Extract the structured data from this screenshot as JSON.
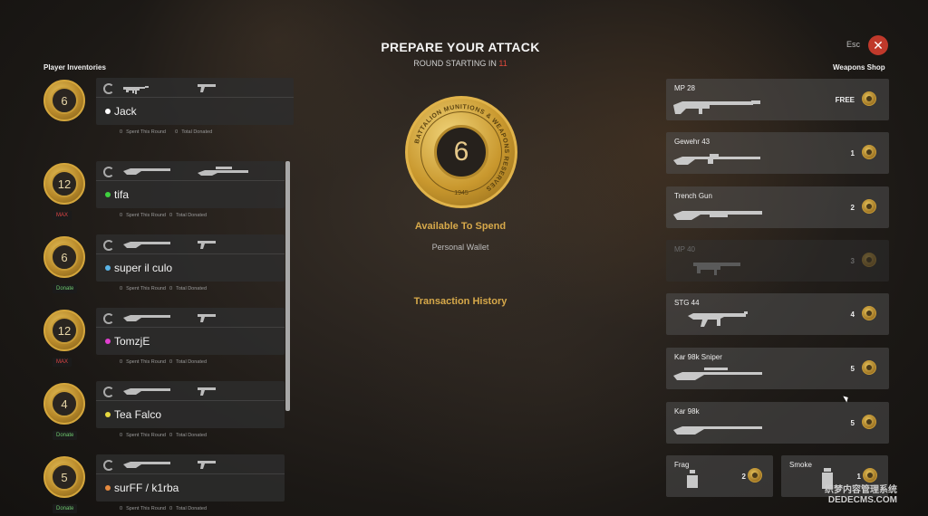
{
  "header": {
    "title": "PREPARE YOUR ATTACK",
    "round_prefix": "ROUND STARTING IN ",
    "round_count": "11",
    "esc_label": "Esc",
    "close_glyph": "✕"
  },
  "left": {
    "label": "Player Inventories",
    "stat_spent_label": "Spent This Round",
    "stat_donated_label": "Total Donated",
    "players": [
      {
        "name": "Jack",
        "coins": "6",
        "dot": "#ffffff",
        "tag": "",
        "spent": "0",
        "donated": "0"
      },
      {
        "name": "tifa",
        "coins": "12",
        "dot": "#3fd13f",
        "tag": "MAX",
        "spent": "0",
        "donated": "0"
      },
      {
        "name": "super il culo",
        "coins": "6",
        "dot": "#5ab4e6",
        "tag": "Donate",
        "spent": "0",
        "donated": "0"
      },
      {
        "name": "TomzjE",
        "coins": "12",
        "dot": "#e13fd0",
        "tag": "MAX",
        "spent": "0",
        "donated": "0"
      },
      {
        "name": "Tea Falco",
        "coins": "4",
        "dot": "#e6d83f",
        "tag": "Donate",
        "spent": "0",
        "donated": "0"
      },
      {
        "name": "surFF / k1rba",
        "coins": "5",
        "dot": "#e68a3f",
        "tag": "Donate",
        "spent": "0",
        "donated": "0"
      }
    ]
  },
  "center": {
    "coin_value": "6",
    "coin_ring_text": "BATTALION MUNITIONS & WEAPONS RESERVES",
    "coin_year": "1945",
    "available_label": "Available To Spend",
    "wallet_label": "Personal Wallet",
    "history_label": "Transaction History"
  },
  "shop": {
    "label": "Weapons Shop",
    "items": [
      {
        "name": "MP 28",
        "price": "FREE"
      },
      {
        "name": "Gewehr 43",
        "price": "1"
      },
      {
        "name": "Trench Gun",
        "price": "2"
      },
      {
        "name": "MP 40",
        "price": "3"
      },
      {
        "name": "STG 44",
        "price": "4"
      },
      {
        "name": "Kar 98k Sniper",
        "price": "5"
      },
      {
        "name": "Kar 98k",
        "price": "5"
      }
    ],
    "equipment": [
      {
        "name": "Frag",
        "price": "2"
      },
      {
        "name": "Smoke",
        "price": "1"
      }
    ]
  },
  "watermark": {
    "line1": "织梦内容管理系统",
    "line2": "DEDECMS.COM"
  },
  "colors": {
    "gold": "#d7a94a",
    "max_tag": "#e04545",
    "donate_tag": "#6ec86e",
    "close_red": "#c0392b"
  }
}
